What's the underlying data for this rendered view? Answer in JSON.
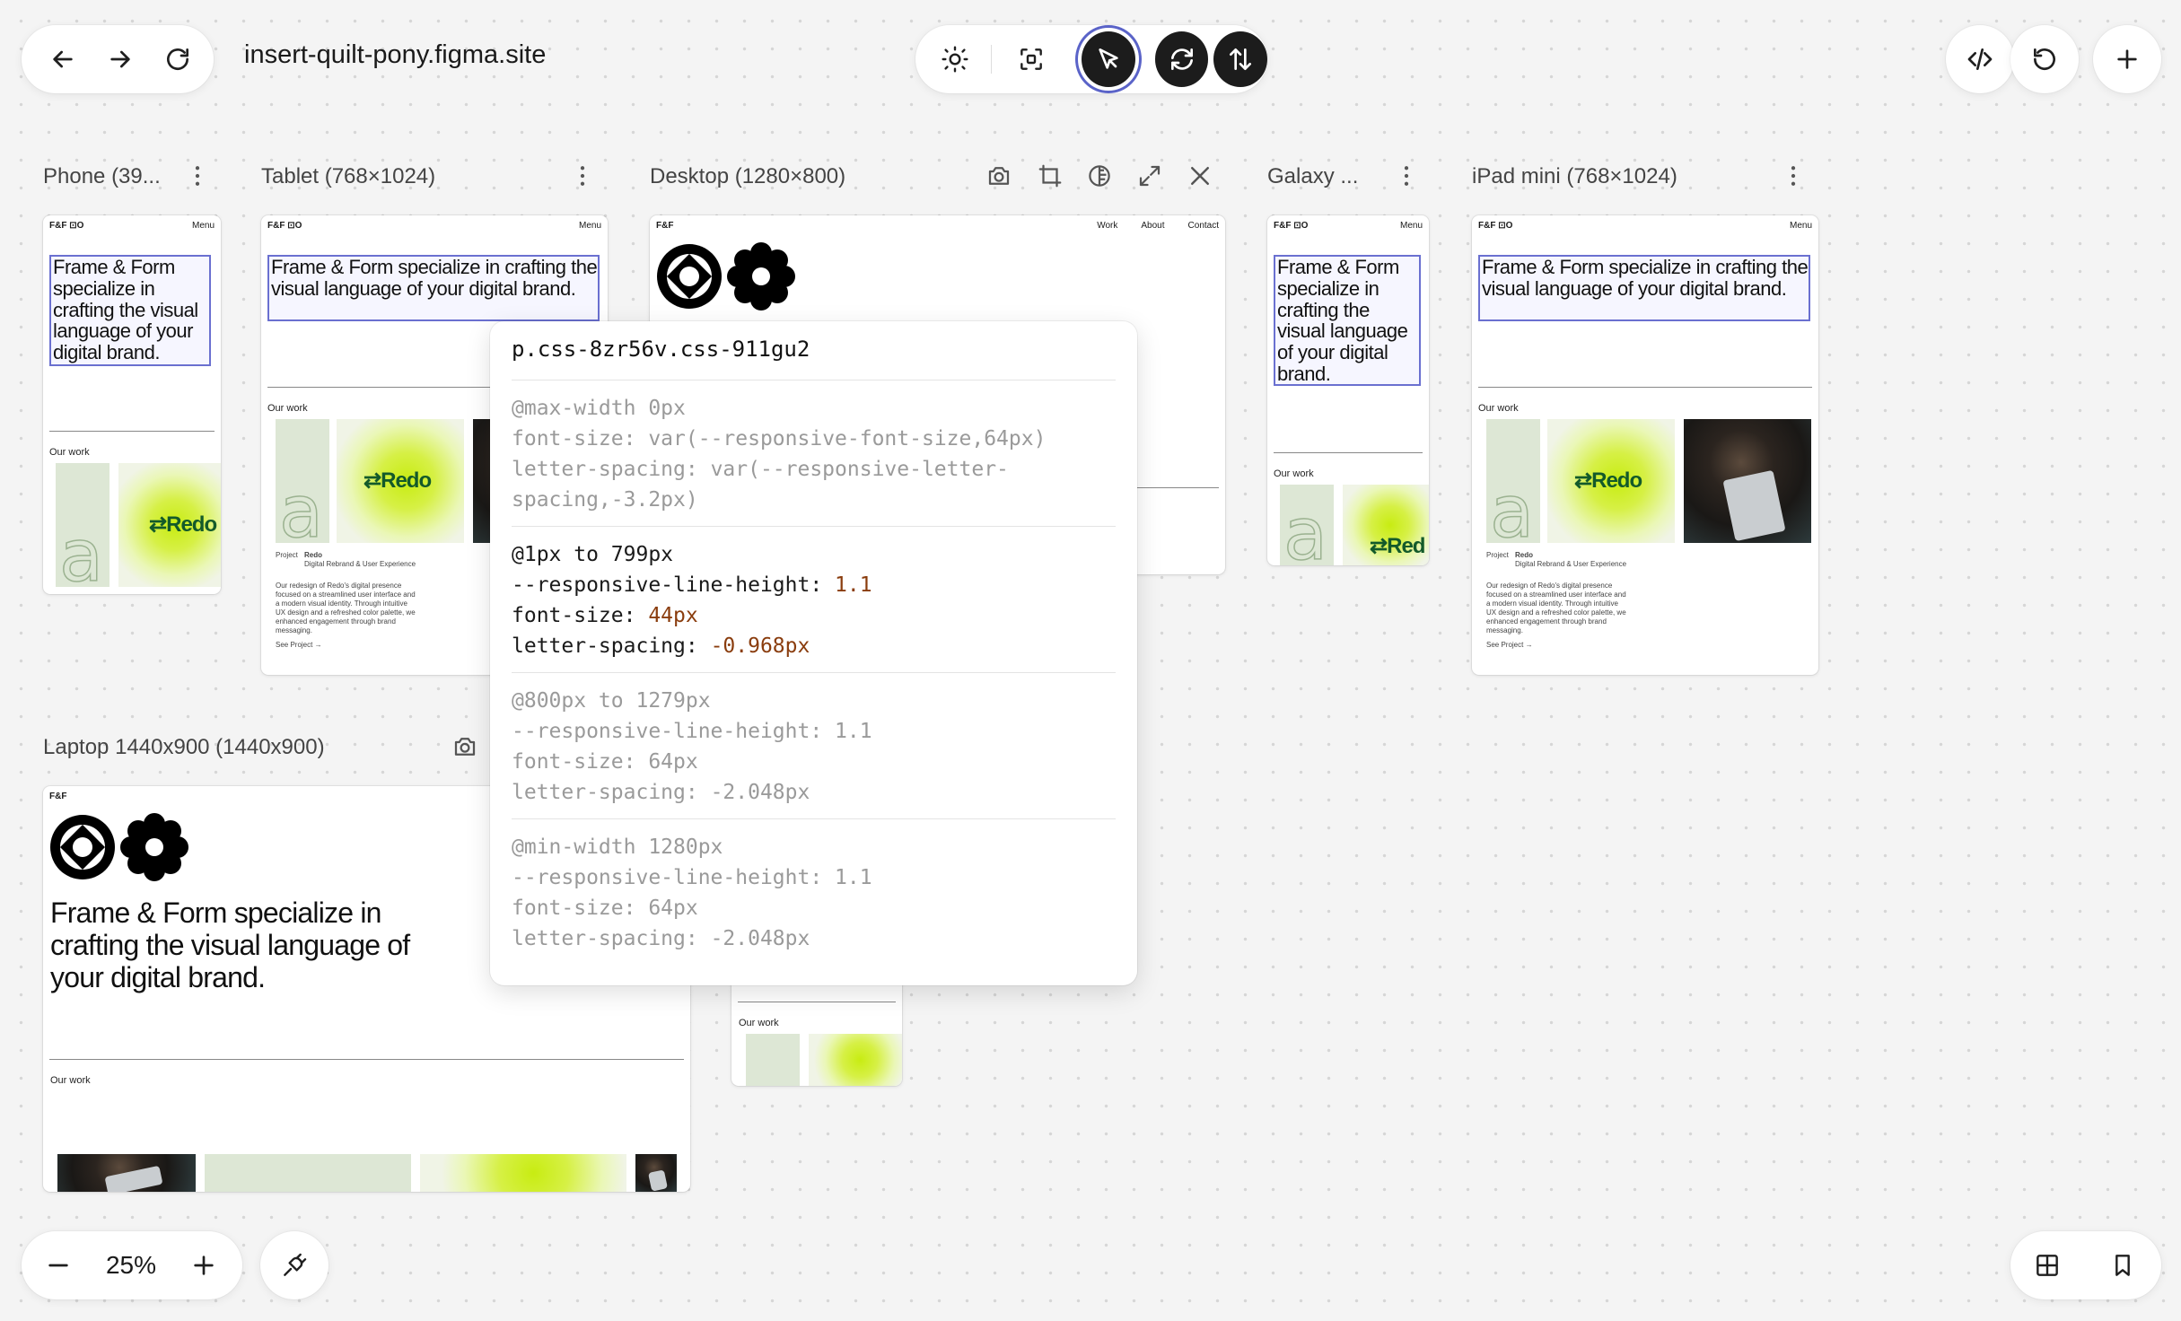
{
  "browser": {
    "url": "insert-quilt-pony.figma.site",
    "nav": [
      "back-icon",
      "forward-icon",
      "reload-icon"
    ]
  },
  "toolbar": {
    "icons": [
      "sun-icon",
      "focus-frame-icon",
      "cursor-select-icon",
      "sync-icon",
      "swap-vertical-icon"
    ],
    "right_icons": [
      "code-icon",
      "undo-icon",
      "plus-icon"
    ]
  },
  "frames": {
    "phone": {
      "label": "Phone (39..."
    },
    "tablet": {
      "label": "Tablet (768×1024)"
    },
    "desktop": {
      "label": "Desktop (1280×800)"
    },
    "galaxy": {
      "label": "Galaxy ..."
    },
    "ipad": {
      "label": "iPad mini (768×1024)"
    },
    "laptop": {
      "label": "Laptop 1440x900 (1440x900)"
    }
  },
  "site": {
    "logo": "F&F",
    "logo_mark": "F&F ⊡O",
    "menu": "Menu",
    "nav_links": [
      "Work",
      "About",
      "Contact"
    ],
    "headline": "Frame & Form specialize in crafting the visual language of your digital brand.",
    "our_work": "Our work",
    "project_label": "Project",
    "project_name": "Redo",
    "project_type": "Digital Rebrand & User Experience",
    "project_desc": "Our redesign of Redo's digital presence focused on a streamlined user interface and a modern visual identity. Through intuitive UX design and a refreshed color palette, we enhanced engagement through brand messaging.",
    "see_project": "See Project →",
    "redo": "⇄Redo",
    "redo_cut": "⇄Red",
    "letter": "a"
  },
  "popover": {
    "selector": "p.css-8zr56v.css-911gu2",
    "blocks": [
      {
        "header": "@max-width 0px",
        "state": "dim",
        "lines": [
          {
            "k": "font-size: ",
            "v": "var(--responsive-font-size,64px)"
          },
          {
            "k": "letter-spacing: ",
            "v": "var(--responsive-letter-spacing,-3.2px)"
          }
        ]
      },
      {
        "header": "@1px to 799px",
        "state": "active",
        "lines": [
          {
            "k": "--responsive-line-height: ",
            "v": "1.1"
          },
          {
            "k": "font-size: ",
            "v": "44px"
          },
          {
            "k": "letter-spacing: ",
            "v": "-0.968px"
          }
        ]
      },
      {
        "header": "@800px to 1279px",
        "state": "dim",
        "lines": [
          {
            "k": "--responsive-line-height: ",
            "v": "1.1"
          },
          {
            "k": "font-size: ",
            "v": "64px"
          },
          {
            "k": "letter-spacing: ",
            "v": "-2.048px"
          }
        ]
      },
      {
        "header": "@min-width 1280px",
        "state": "dim",
        "lines": [
          {
            "k": "--responsive-line-height: ",
            "v": "1.1"
          },
          {
            "k": "font-size: ",
            "v": "64px"
          },
          {
            "k": "letter-spacing: ",
            "v": "-2.048px"
          }
        ]
      }
    ]
  },
  "zoom": {
    "value": "25%"
  },
  "colors": {
    "selection": "#6a70d0",
    "redo_green": "#135a2a",
    "lime": "#c8ec12",
    "value_brown": "#8a3d0e"
  }
}
